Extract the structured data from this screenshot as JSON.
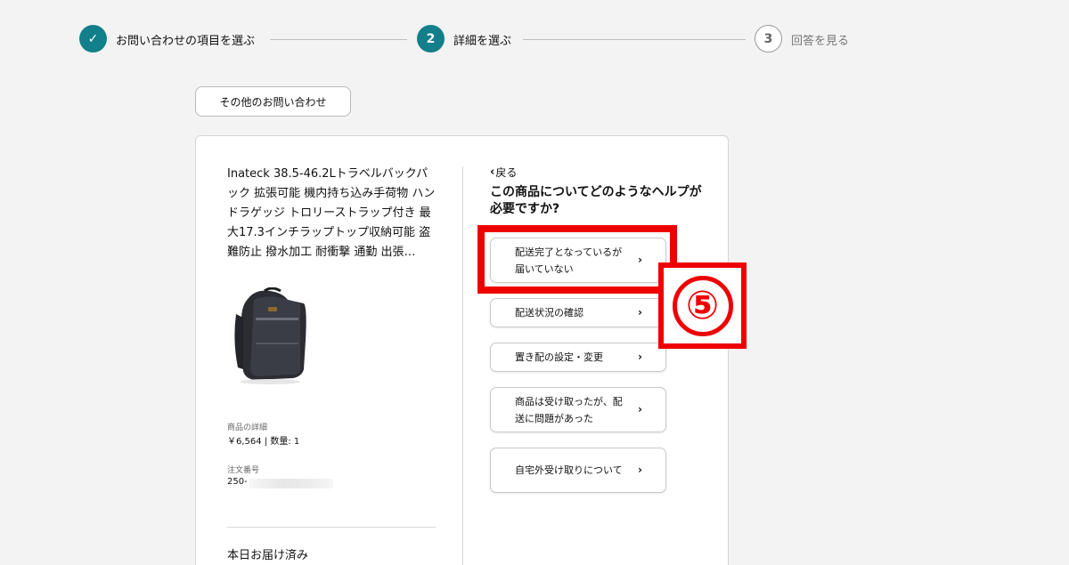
{
  "stepper": {
    "steps": [
      {
        "number": "✓",
        "label": "お問い合わせの項目を選ぶ",
        "state": "done"
      },
      {
        "number": "2",
        "label": "詳細を選ぶ",
        "state": "active"
      },
      {
        "number": "3",
        "label": "回答を見る",
        "state": "pending"
      }
    ]
  },
  "other_inquiries_label": "その他のお問い合わせ",
  "product": {
    "title": "Inateck 38.5-46.2Lトラベルバックパック 拡張可能 機内持ち込み手荷物 ハンドラゲッジ トロリーストラップ付き 最大17.3インチラップトップ収納可能 盗難防止 撥水加工 耐衝撃 通勤 出張…",
    "details_label": "商品の詳細",
    "price_qty": "￥6,564 | 数量: 1",
    "order_label": "注文番号",
    "order_number": "250-",
    "status": "本日お届け済み"
  },
  "help": {
    "back_label": "戻る",
    "question": "この商品についてどのようなヘルプが必要ですか?",
    "options": [
      "配送完了となっているが届いていない",
      "配送状況の確認",
      "置き配の設定・変更",
      "商品は受け取ったが、配送に問題があった",
      "自宅外受け取りについて"
    ]
  },
  "annotation": {
    "number": "⑤",
    "color": "#ee0000"
  },
  "colors": {
    "accent": "#137f8a"
  },
  "icons": {
    "step_done": "check-icon",
    "back": "chevron-left-icon",
    "option_arrow": "chevron-right-icon"
  }
}
